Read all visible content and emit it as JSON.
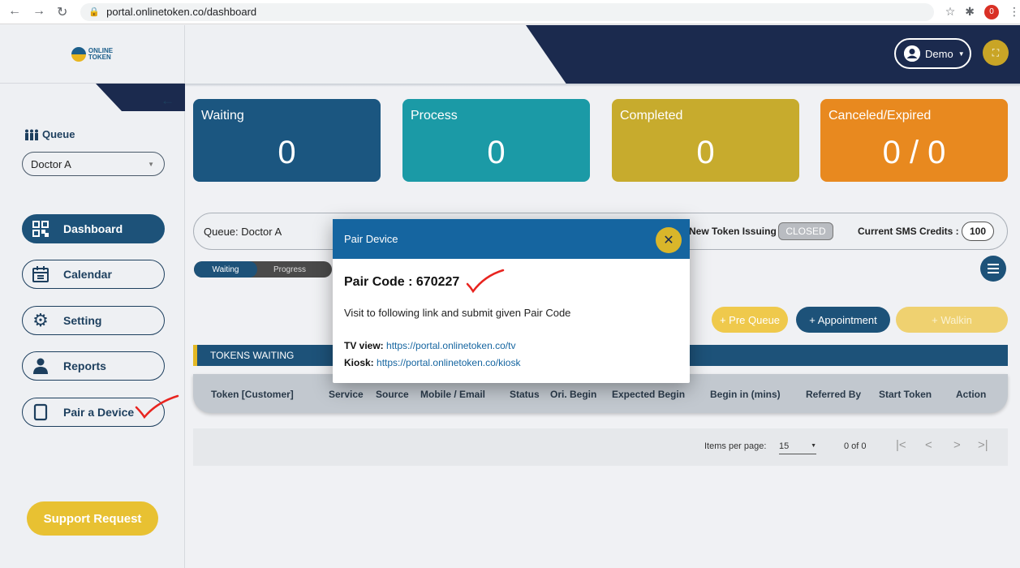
{
  "browser": {
    "url": "portal.onlinetoken.co/dashboard",
    "ext_badge": "0"
  },
  "logo": {
    "line1": "ONLINE",
    "line2": "TOKEN"
  },
  "header": {
    "user": "Demo"
  },
  "sidebar": {
    "queue_label": "Queue",
    "queue_select": "Doctor A",
    "items": [
      {
        "label": "Dashboard",
        "icon": "qr-icon"
      },
      {
        "label": "Calendar",
        "icon": "calendar-icon"
      },
      {
        "label": "Setting",
        "icon": "gear-icon"
      },
      {
        "label": "Reports",
        "icon": "user-icon"
      },
      {
        "label": "Pair a Device",
        "icon": "tablet-icon"
      }
    ],
    "support": "Support Request"
  },
  "stats": [
    {
      "title": "Waiting",
      "value": "0",
      "color": "#1b5680"
    },
    {
      "title": "Process",
      "value": "0",
      "color": "#1b9aa6"
    },
    {
      "title": "Completed",
      "value": "0",
      "color": "#c7ab2d"
    },
    {
      "title": "Canceled/Expired",
      "value": "0 / 0",
      "color": "#e8891f"
    }
  ],
  "infobar": {
    "queue": "Queue:  Doctor A",
    "new_token_label": "New Token Issuing :",
    "new_token_status": "CLOSED",
    "sms_label": "Current SMS Credits :",
    "sms_value": "100"
  },
  "toggle": {
    "waiting": "Waiting",
    "progress": "Progress"
  },
  "actions": {
    "pre_queue": "+ Pre Queue",
    "appointment": "+ Appointment",
    "walkin": "+ Walkin"
  },
  "tokens_header": "TOKENS WAITING",
  "columns": [
    "Token [Customer]",
    "Service",
    "Source",
    "Mobile / Email",
    "Status",
    "Ori. Begin",
    "Expected Begin",
    "Begin in (mins)",
    "Referred By",
    "Start Token",
    "Action"
  ],
  "pager": {
    "label": "Items per page:",
    "size": "15",
    "range": "0 of 0"
  },
  "modal": {
    "title": "Pair Device",
    "pair_code": "Pair Code : 670227",
    "instruction": "Visit to following link and submit given Pair Code",
    "tv_label": "TV view:",
    "tv_link": "https://portal.onlinetoken.co/tv",
    "kiosk_label": "Kiosk:",
    "kiosk_link": "https://portal.onlinetoken.co/kiosk"
  }
}
